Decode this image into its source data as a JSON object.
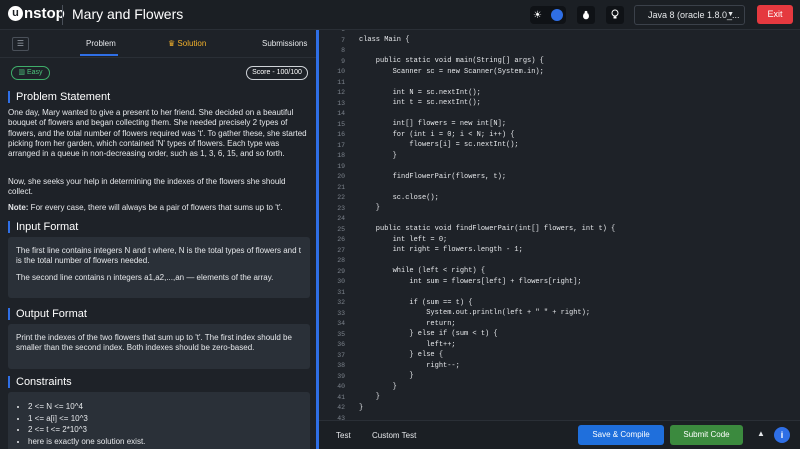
{
  "header": {
    "logo_text": "nstop",
    "logo_u": "u",
    "title": "Mary and Flowers",
    "language": "Java 8 (oracle 1.8.0_...",
    "exit_label": "Exit"
  },
  "tabs": {
    "problem": "Problem",
    "solution": "Solution",
    "submissions": "Submissions"
  },
  "badges": {
    "difficulty": "Easy",
    "score": "Score - 100/100"
  },
  "problem": {
    "heading": "Problem Statement",
    "p1": "One day, Mary wanted to give a present to her friend. She decided on a beautiful bouquet of flowers and began collecting them. She needed precisely 2 types of flowers, and the total number of flowers required was 't'. To gather these, she started picking from her garden, which contained 'N' types of flowers. Each type was arranged in a queue in non-decreasing order, such as 1, 3, 6, 15, and so forth.",
    "p2": "Now, she seeks your help in determining the indexes of the flowers she should collect.",
    "note_label": "Note:",
    "note_text": " For every case, there will always be a pair of flowers that sums up to 't'."
  },
  "input_format": {
    "heading": "Input Format",
    "line1": "The first line contains integers N and t where, N is the total types of flowers and t is the total number of flowers needed.",
    "line2": "The second line contains n integers a1,a2,...,an — elements of the array."
  },
  "output_format": {
    "heading": "Output Format",
    "line1": "Print the indexes of the two flowers that sum up to 't'. The first index should be smaller than the second index. Both indexes should be zero-based."
  },
  "constraints": {
    "heading": "Constraints",
    "items": [
      "2 <= N <= 10^4",
      "1 <= a[i] <= 10^3",
      "2 <= t <= 2*10^3",
      "here is exactly one solution exist."
    ]
  },
  "editor": {
    "lines": [
      {
        "n": "6",
        "code": ""
      },
      {
        "n": "7",
        "code": "class Main {"
      },
      {
        "n": "8",
        "code": ""
      },
      {
        "n": "9",
        "code": "    public static void main(String[] args) {"
      },
      {
        "n": "10",
        "code": "        Scanner sc = new Scanner(System.in);"
      },
      {
        "n": "11",
        "code": ""
      },
      {
        "n": "12",
        "code": "        int N = sc.nextInt();"
      },
      {
        "n": "13",
        "code": "        int t = sc.nextInt();"
      },
      {
        "n": "14",
        "code": ""
      },
      {
        "n": "15",
        "code": "        int[] flowers = new int[N];"
      },
      {
        "n": "16",
        "code": "        for (int i = 0; i < N; i++) {"
      },
      {
        "n": "17",
        "code": "            flowers[i] = sc.nextInt();"
      },
      {
        "n": "18",
        "code": "        }"
      },
      {
        "n": "19",
        "code": ""
      },
      {
        "n": "20",
        "code": "        findFlowerPair(flowers, t);"
      },
      {
        "n": "21",
        "code": ""
      },
      {
        "n": "22",
        "code": "        sc.close();"
      },
      {
        "n": "23",
        "code": "    }"
      },
      {
        "n": "24",
        "code": ""
      },
      {
        "n": "25",
        "code": "    public static void findFlowerPair(int[] flowers, int t) {"
      },
      {
        "n": "26",
        "code": "        int left = 0;"
      },
      {
        "n": "27",
        "code": "        int right = flowers.length - 1;"
      },
      {
        "n": "28",
        "code": ""
      },
      {
        "n": "29",
        "code": "        while (left < right) {"
      },
      {
        "n": "30",
        "code": "            int sum = flowers[left] + flowers[right];"
      },
      {
        "n": "31",
        "code": ""
      },
      {
        "n": "32",
        "code": "            if (sum == t) {"
      },
      {
        "n": "33",
        "code": "                System.out.println(left + \" \" + right);"
      },
      {
        "n": "34",
        "code": "                return;"
      },
      {
        "n": "35",
        "code": "            } else if (sum < t) {"
      },
      {
        "n": "36",
        "code": "                left++;"
      },
      {
        "n": "37",
        "code": "            } else {"
      },
      {
        "n": "38",
        "code": "                right--;"
      },
      {
        "n": "39",
        "code": "            }"
      },
      {
        "n": "40",
        "code": "        }"
      },
      {
        "n": "41",
        "code": "    }"
      },
      {
        "n": "42",
        "code": "}"
      },
      {
        "n": "43",
        "code": ""
      }
    ]
  },
  "bottom": {
    "test": "Test",
    "custom_test": "Custom Test",
    "save_compile": "Save & Compile",
    "submit": "Submit Code"
  },
  "colors": {
    "accent": "#2f6fe6",
    "exit": "#e5393f",
    "submit": "#3b8a3e",
    "easy": "#4cc47c",
    "solution": "#f3b12b"
  }
}
